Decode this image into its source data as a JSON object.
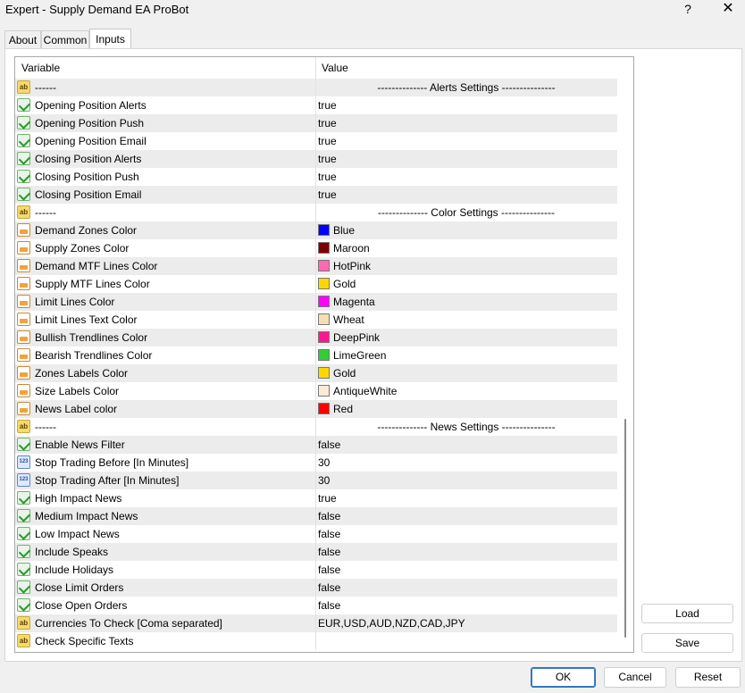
{
  "window": {
    "title": "Expert - Supply Demand EA ProBot",
    "help_label": "?",
    "close_label": "✕"
  },
  "tabs": [
    {
      "label": "About"
    },
    {
      "label": "Common"
    },
    {
      "label": "Inputs",
      "active": true
    }
  ],
  "grid": {
    "headers": {
      "variable": "Variable",
      "value": "Value"
    },
    "rows": [
      {
        "icon": "ab",
        "variable": "------",
        "value": "-------------- Alerts Settings ---------------",
        "separator": true
      },
      {
        "icon": "bool",
        "variable": "Opening Position  Alerts",
        "value": "true"
      },
      {
        "icon": "bool",
        "variable": "Opening Position  Push",
        "value": "true"
      },
      {
        "icon": "bool",
        "variable": "Opening Position  Email",
        "value": "true"
      },
      {
        "icon": "bool",
        "variable": "Closing Position  Alerts",
        "value": "true"
      },
      {
        "icon": "bool",
        "variable": "Closing Position  Push",
        "value": "true"
      },
      {
        "icon": "bool",
        "variable": "Closing Position  Email",
        "value": "true"
      },
      {
        "icon": "ab",
        "variable": "------",
        "value": "-------------- Color Settings ---------------",
        "separator": true
      },
      {
        "icon": "color",
        "variable": "Demand Zones Color",
        "value": "Blue",
        "swatch": "#0000ff"
      },
      {
        "icon": "color",
        "variable": "Supply Zones Color",
        "value": "Maroon",
        "swatch": "#800000"
      },
      {
        "icon": "color",
        "variable": "Demand MTF Lines Color",
        "value": "HotPink",
        "swatch": "#ff69b4"
      },
      {
        "icon": "color",
        "variable": "Supply MTF Lines Color",
        "value": "Gold",
        "swatch": "#ffd700"
      },
      {
        "icon": "color",
        "variable": "Limit Lines Color",
        "value": "Magenta",
        "swatch": "#ff00ff"
      },
      {
        "icon": "color",
        "variable": "Limit Lines Text Color",
        "value": "Wheat",
        "swatch": "#f5deb3"
      },
      {
        "icon": "color",
        "variable": "Bullish Trendlines Color",
        "value": "DeepPink",
        "swatch": "#ff1493"
      },
      {
        "icon": "color",
        "variable": "Bearish Trendlines Color",
        "value": "LimeGreen",
        "swatch": "#32cd32"
      },
      {
        "icon": "color",
        "variable": "Zones Labels Color",
        "value": "Gold",
        "swatch": "#ffd700"
      },
      {
        "icon": "color",
        "variable": "Size Labels Color",
        "value": "AntiqueWhite",
        "swatch": "#faebd7"
      },
      {
        "icon": "color",
        "variable": "News Label color",
        "value": "Red",
        "swatch": "#ff0000"
      },
      {
        "icon": "ab",
        "variable": "------",
        "value": "-------------- News Settings ---------------",
        "separator": true
      },
      {
        "icon": "bool",
        "variable": "Enable News Filter",
        "value": "false"
      },
      {
        "icon": "num",
        "variable": "Stop Trading Before [In Minutes]",
        "value": "30"
      },
      {
        "icon": "num",
        "variable": "Stop Trading After [In Minutes]",
        "value": "30"
      },
      {
        "icon": "bool",
        "variable": "High Impact News",
        "value": "true"
      },
      {
        "icon": "bool",
        "variable": "Medium Impact News",
        "value": "false"
      },
      {
        "icon": "bool",
        "variable": "Low Impact News",
        "value": "false"
      },
      {
        "icon": "bool",
        "variable": "Include Speaks",
        "value": "false"
      },
      {
        "icon": "bool",
        "variable": "Include Holidays",
        "value": "false"
      },
      {
        "icon": "bool",
        "variable": "Close Limit Orders",
        "value": "false"
      },
      {
        "icon": "bool",
        "variable": "Close Open Orders",
        "value": "false"
      },
      {
        "icon": "ab",
        "variable": "Currencies To Check [Coma separated]",
        "value": "EUR,USD,AUD,NZD,CAD,JPY"
      },
      {
        "icon": "ab",
        "variable": "Check Specific Texts",
        "value": ""
      }
    ]
  },
  "side_buttons": {
    "load": "Load",
    "save": "Save"
  },
  "bottom_buttons": {
    "ok": "OK",
    "cancel": "Cancel",
    "reset": "Reset"
  }
}
